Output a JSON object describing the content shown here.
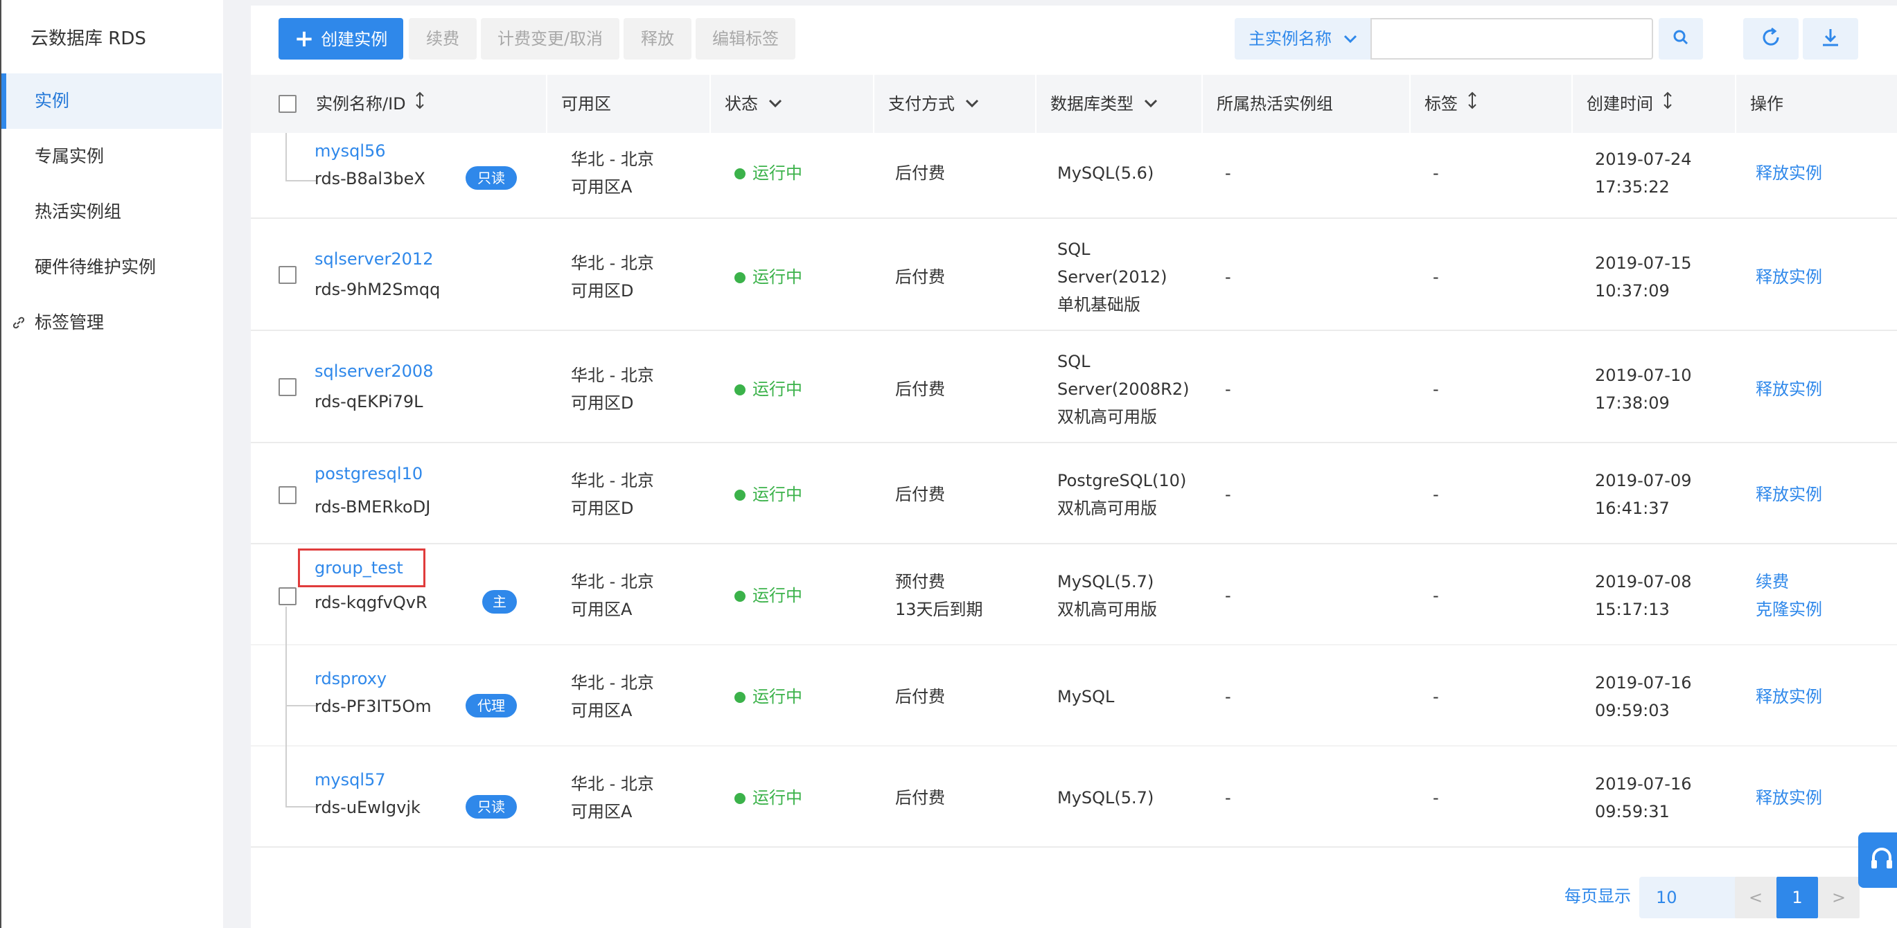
{
  "sidebar": {
    "title": "云数据库 RDS",
    "items": [
      {
        "label": "实例"
      },
      {
        "label": "专属实例"
      },
      {
        "label": "热活实例组"
      },
      {
        "label": "硬件待维护实例"
      },
      {
        "label": "标签管理"
      }
    ]
  },
  "toolbar": {
    "create_label": "创建实例",
    "renew_label": "续费",
    "billing_label": "计费变更/取消",
    "release_label": "释放",
    "edit_tags_label": "编辑标签",
    "filter_label": "主实例名称",
    "search_value": ""
  },
  "table": {
    "headers": {
      "name": "实例名称/ID",
      "zone": "可用区",
      "status": "状态",
      "payment": "支付方式",
      "dbtype": "数据库类型",
      "hotgroup": "所属热活实例组",
      "tags": "标签",
      "created": "创建时间",
      "actions": "操作"
    },
    "rows": [
      {
        "name": "mysql56",
        "id": "rds-B8al3beX",
        "badge": "只读",
        "zone1": "华北 - 北京",
        "zone2": "可用区A",
        "status": "运行中",
        "pay1": "后付费",
        "pay2": "",
        "db1": "MySQL(5.6)",
        "db2": "",
        "db3": "",
        "hotgroup": "-",
        "tags": "-",
        "date": "2019-07-24",
        "time": "17:35:22",
        "action1": "释放实例",
        "action2": ""
      },
      {
        "name": "sqlserver2012",
        "id": "rds-9hM2Smqq",
        "badge": "",
        "zone1": "华北 - 北京",
        "zone2": "可用区D",
        "status": "运行中",
        "pay1": "后付费",
        "pay2": "",
        "db1": "SQL",
        "db2": "Server(2012)",
        "db3": "单机基础版",
        "hotgroup": "-",
        "tags": "-",
        "date": "2019-07-15",
        "time": "10:37:09",
        "action1": "释放实例",
        "action2": ""
      },
      {
        "name": "sqlserver2008",
        "id": "rds-qEKPi79L",
        "badge": "",
        "zone1": "华北 - 北京",
        "zone2": "可用区D",
        "status": "运行中",
        "pay1": "后付费",
        "pay2": "",
        "db1": "SQL",
        "db2": "Server(2008R2)",
        "db3": "双机高可用版",
        "hotgroup": "-",
        "tags": "-",
        "date": "2019-07-10",
        "time": "17:38:09",
        "action1": "释放实例",
        "action2": ""
      },
      {
        "name": "postgresql10",
        "id": "rds-BMERkoDJ",
        "badge": "",
        "zone1": "华北 - 北京",
        "zone2": "可用区D",
        "status": "运行中",
        "pay1": "后付费",
        "pay2": "",
        "db1": "PostgreSQL(10)",
        "db2": "双机高可用版",
        "db3": "",
        "hotgroup": "-",
        "tags": "-",
        "date": "2019-07-09",
        "time": "16:41:37",
        "action1": "释放实例",
        "action2": ""
      },
      {
        "name": "group_test",
        "id": "rds-kqgfvQvR",
        "badge": "主",
        "zone1": "华北 - 北京",
        "zone2": "可用区A",
        "status": "运行中",
        "pay1": "预付费",
        "pay2": "13天后到期",
        "db1": "MySQL(5.7)",
        "db2": "双机高可用版",
        "db3": "",
        "hotgroup": "-",
        "tags": "-",
        "date": "2019-07-08",
        "time": "15:17:13",
        "action1": "续费",
        "action2": "克隆实例"
      },
      {
        "name": "rdsproxy",
        "id": "rds-PF3IT5Om",
        "badge": "代理",
        "zone1": "华北 - 北京",
        "zone2": "可用区A",
        "status": "运行中",
        "pay1": "后付费",
        "pay2": "",
        "db1": "MySQL",
        "db2": "",
        "db3": "",
        "hotgroup": "-",
        "tags": "-",
        "date": "2019-07-16",
        "time": "09:59:03",
        "action1": "释放实例",
        "action2": ""
      },
      {
        "name": "mysql57",
        "id": "rds-uEwIgvjk",
        "badge": "只读",
        "zone1": "华北 - 北京",
        "zone2": "可用区A",
        "status": "运行中",
        "pay1": "后付费",
        "pay2": "",
        "db1": "MySQL(5.7)",
        "db2": "",
        "db3": "",
        "hotgroup": "-",
        "tags": "-",
        "date": "2019-07-16",
        "time": "09:59:31",
        "action1": "释放实例",
        "action2": ""
      }
    ]
  },
  "pagination": {
    "per_page_label": "每页显示",
    "page_size": "10",
    "prev": "<",
    "current": "1",
    "next": ">"
  },
  "colors": {
    "accent": "#2f88ea",
    "running": "#3bb24a",
    "highlight": "#e03c3c"
  }
}
